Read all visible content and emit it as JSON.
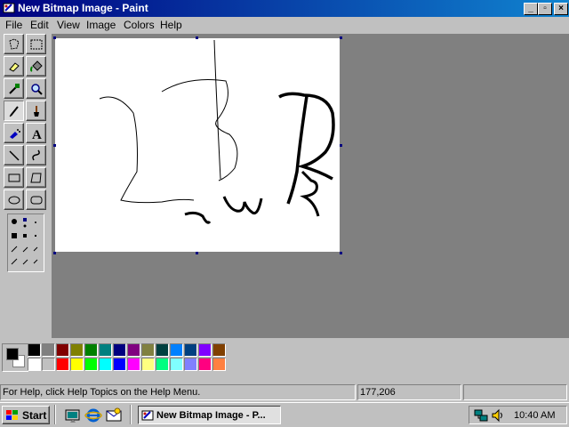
{
  "window": {
    "title": "New Bitmap Image - Paint",
    "controls": {
      "minimize": "_",
      "maximize": "▫",
      "close": "×"
    }
  },
  "menu": [
    "File",
    "Edit",
    "View",
    "Image",
    "Colors",
    "Help"
  ],
  "tools": [
    "free-form-select",
    "select",
    "eraser",
    "fill-with-color",
    "pick-color",
    "magnifier",
    "pencil",
    "brush",
    "airbrush",
    "text",
    "line",
    "curve",
    "rectangle",
    "polygon",
    "ellipse",
    "rounded-rectangle"
  ],
  "active_tool": "pencil",
  "palette": {
    "foreground": "#000000",
    "background": "#ffffff",
    "top_row": [
      "#000000",
      "#808080",
      "#800000",
      "#808000",
      "#008000",
      "#008080",
      "#000080",
      "#800080",
      "#808040",
      "#004040",
      "#0080ff",
      "#004080",
      "#8000ff",
      "#804000"
    ],
    "bottom_row": [
      "#ffffff",
      "#c0c0c0",
      "#ff0000",
      "#ffff00",
      "#00ff00",
      "#00ffff",
      "#0000ff",
      "#ff00ff",
      "#ffff80",
      "#00ff80",
      "#80ffff",
      "#8080ff",
      "#ff0080",
      "#ff8040"
    ]
  },
  "status": {
    "help": "For Help, click Help Topics on the Help Menu.",
    "coords": "177,206"
  },
  "taskbar": {
    "start": "Start",
    "task_label": "New Bitmap Image - P...",
    "clock": "10:40 AM"
  }
}
